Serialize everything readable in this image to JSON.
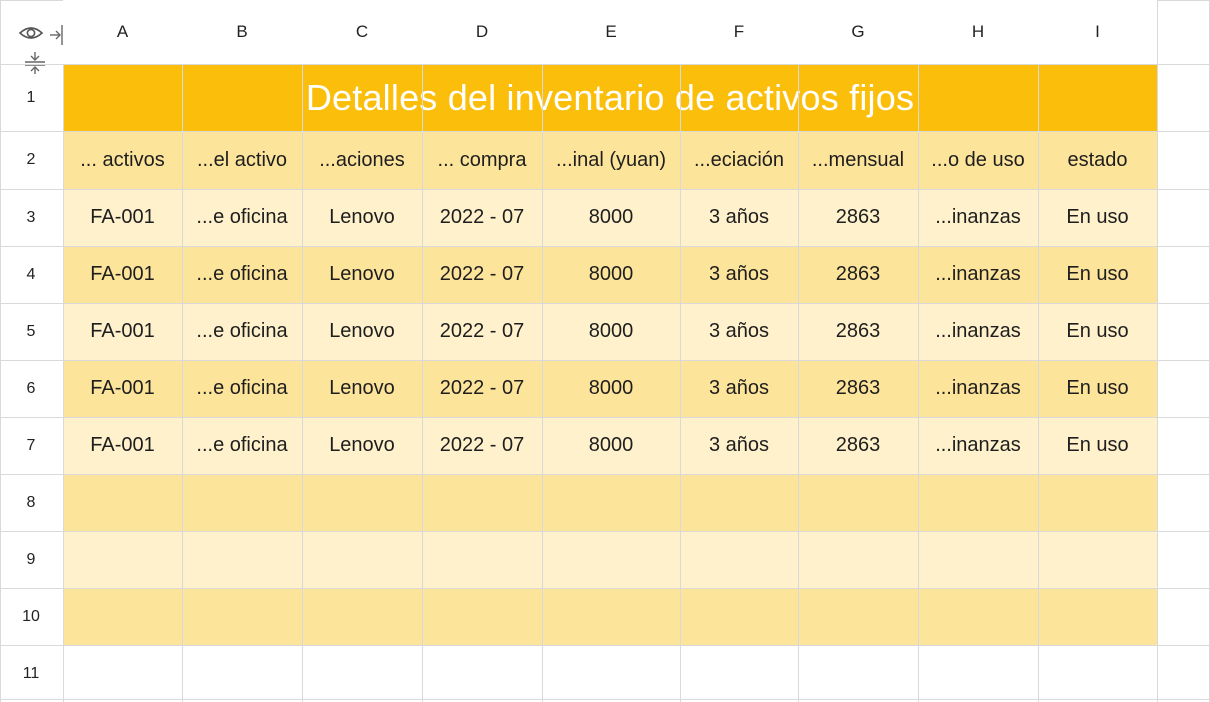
{
  "columns": [
    "A",
    "B",
    "C",
    "D",
    "E",
    "F",
    "G",
    "H",
    "I"
  ],
  "rows": [
    "1",
    "2",
    "3",
    "4",
    "5",
    "6",
    "7",
    "8",
    "9",
    "10",
    "11"
  ],
  "title": "Detalles del inventario de activos fijos",
  "headers": [
    "... activos",
    "...el activo",
    "...aciones",
    "... compra",
    "...inal (yuan)",
    "...eciación",
    "...mensual",
    "...o de uso",
    "estado"
  ],
  "data_rows": [
    [
      "FA-001",
      "...e oficina",
      "Lenovo",
      "2022 - 07",
      "8000",
      "3 años",
      "2863",
      "...inanzas",
      "En uso"
    ],
    [
      "FA-001",
      "...e oficina",
      "Lenovo",
      "2022 - 07",
      "8000",
      "3 años",
      "2863",
      "...inanzas",
      "En uso"
    ],
    [
      "FA-001",
      "...e oficina",
      "Lenovo",
      "2022 - 07",
      "8000",
      "3 años",
      "2863",
      "...inanzas",
      "En uso"
    ],
    [
      "FA-001",
      "...e oficina",
      "Lenovo",
      "2022 - 07",
      "8000",
      "3 años",
      "2863",
      "...inanzas",
      "En uso"
    ],
    [
      "FA-001",
      "...e oficina",
      "Lenovo",
      "2022 - 07",
      "8000",
      "3 años",
      "2863",
      "...inanzas",
      "En uso"
    ]
  ],
  "colors": {
    "title_bg": "#fbbe0a",
    "header_bg": "#fde49b",
    "row_light": "#fef1cc",
    "row_dark": "#fde49b"
  },
  "icons": {
    "visibility": "eye-icon",
    "freeze_columns": "freeze-columns-icon",
    "freeze_rows": "freeze-rows-icon"
  }
}
